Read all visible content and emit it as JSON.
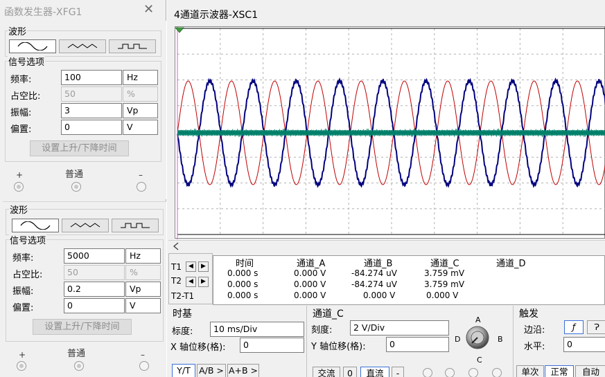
{
  "generator": {
    "title": "函数发生器-XFG1",
    "close": "✕",
    "panel1": {
      "waveform_group": "波形",
      "signal_group": "信号选项",
      "rows": [
        {
          "label": "频率:",
          "value": "100",
          "unit": "Hz",
          "disabled": false
        },
        {
          "label": "占空比:",
          "value": "50",
          "unit": "%",
          "disabled": true
        },
        {
          "label": "振幅:",
          "value": "3",
          "unit": "Vp",
          "disabled": false
        },
        {
          "label": "偏置:",
          "value": "0",
          "unit": "V",
          "disabled": false
        }
      ],
      "rise_fall_button": "设置上升/下降时间",
      "terminal_plus": "+",
      "terminal_common": "普通",
      "terminal_minus": "–"
    },
    "panel2": {
      "waveform_group": "波形",
      "signal_group": "信号选项",
      "rows": [
        {
          "label": "频率:",
          "value": "5000",
          "unit": "Hz",
          "disabled": false
        },
        {
          "label": "占空比:",
          "value": "50",
          "unit": "%",
          "disabled": true
        },
        {
          "label": "振幅:",
          "value": "0.2",
          "unit": "Vp",
          "disabled": false
        },
        {
          "label": "偏置:",
          "value": "0",
          "unit": "V",
          "disabled": false
        }
      ],
      "rise_fall_button": "设置上升/下降时间",
      "terminal_plus": "+",
      "terminal_common": "普通",
      "terminal_minus": "–"
    }
  },
  "scope": {
    "title": "4通道示波器-XSC1",
    "trace_colors": {
      "a": "#c00000",
      "b": "#00007e",
      "c": "#00806a"
    },
    "table": {
      "headers": [
        "时间",
        "通道_A",
        "通道_B",
        "通道_C",
        "通道_D"
      ],
      "rows": [
        {
          "label": "T1",
          "time": "0.000 s",
          "a": "0.000 V",
          "b": "-84.274 uV",
          "c": "3.759 mV"
        },
        {
          "label": "T2",
          "time": "0.000 s",
          "a": "0.000 V",
          "b": "-84.274 uV",
          "c": "3.759 mV"
        },
        {
          "label": "T2-T1",
          "time": "0.000 s",
          "a": "0.000 V",
          "b": "0.000 V",
          "c": "0.000 V"
        }
      ]
    },
    "timebase": {
      "title": "时基",
      "scale_label": "标度:",
      "scale_value": "10 ms/Div",
      "xpos_label": "X 轴位移(格):",
      "xpos_value": "0",
      "mode_buttons": [
        "Y/T",
        "A/B >",
        "A+B >"
      ]
    },
    "channel": {
      "title": "通道_C",
      "scale_label": "刻度:",
      "scale_value": "2  V/Div",
      "ypos_label": "Y 轴位移(格):",
      "ypos_value": "0",
      "coupling_buttons": [
        "交流",
        "0",
        "直流",
        "-"
      ],
      "knob_labels": {
        "a": "A",
        "b": "B",
        "c": "C",
        "d": "D"
      }
    },
    "trigger": {
      "title": "触发",
      "edge_label": "边沿:",
      "edge_rise": "ƒ",
      "edge_fall": "Ɂ",
      "level_label": "水平:",
      "level_value": "0",
      "mode_buttons": [
        "单次",
        "正常",
        "自动"
      ]
    }
  }
}
